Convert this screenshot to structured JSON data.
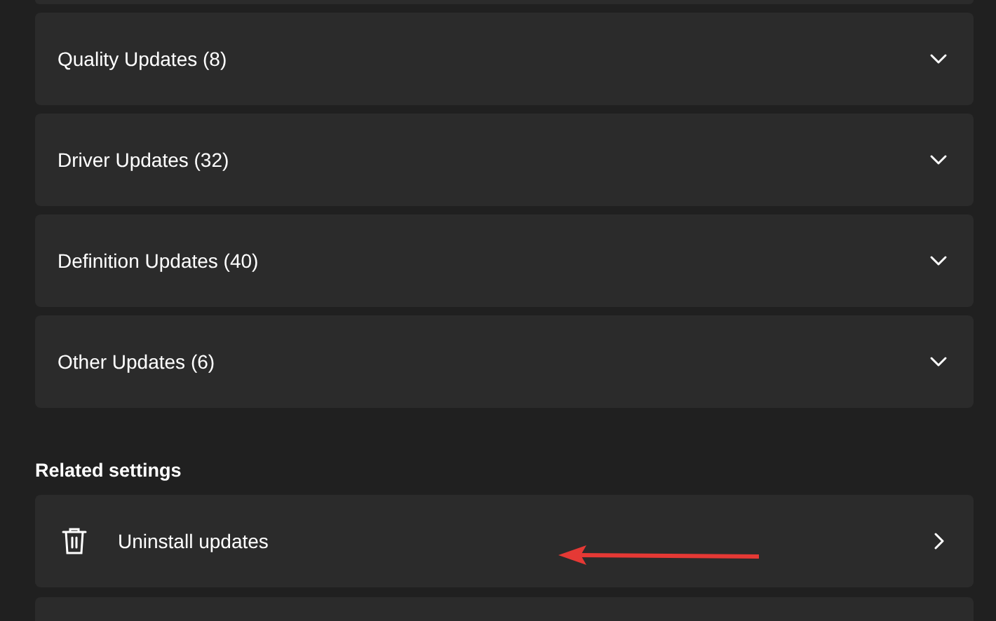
{
  "update_groups": [
    {
      "label": "Quality Updates (8)",
      "expanded": false
    },
    {
      "label": "Driver Updates (32)",
      "expanded": false
    },
    {
      "label": "Definition Updates (40)",
      "expanded": false
    },
    {
      "label": "Other Updates (6)",
      "expanded": false
    }
  ],
  "related_settings": {
    "heading": "Related settings",
    "items": [
      {
        "kind": "trash",
        "label": "Uninstall updates"
      }
    ]
  }
}
